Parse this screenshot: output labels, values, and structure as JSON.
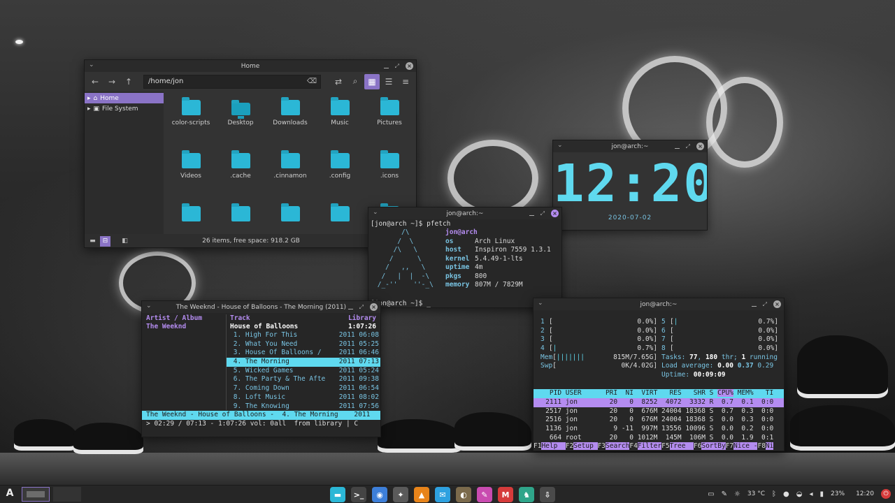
{
  "file_manager": {
    "title": "Home",
    "path": "/home/jon",
    "sidebar": [
      {
        "label": "Home",
        "selected": true
      },
      {
        "label": "File System",
        "selected": false
      }
    ],
    "items": [
      "color-scripts",
      "Desktop",
      "Downloads",
      "Music",
      "Pictures",
      "Videos",
      ".cache",
      ".cinnamon",
      ".config",
      ".icons",
      "",
      "",
      "",
      "",
      ""
    ],
    "status": "26 items, free space: 918.2 GB"
  },
  "clock": {
    "title": "jon@arch:~",
    "time": "12:20",
    "date": "2020-07-02"
  },
  "pfetch": {
    "title": "jon@arch:~",
    "prompt": "[jon@arch ~]$ pfetch",
    "user": "jon@arch",
    "rows": [
      {
        "key": "os",
        "value": "Arch Linux"
      },
      {
        "key": "host",
        "value": "Inspiron 7559 1.3.1"
      },
      {
        "key": "kernel",
        "value": "5.4.49-1-lts"
      },
      {
        "key": "uptime",
        "value": "4m"
      },
      {
        "key": "pkgs",
        "value": "800"
      },
      {
        "key": "memory",
        "value": "807M / 7829M"
      }
    ],
    "prompt2": "[jon@arch ~]$ _"
  },
  "cmus": {
    "title": "The Weeknd - House of Balloons - The Morning (2011)",
    "col_artist": "Artist / Album",
    "col_track": "Track",
    "col_library": "Library",
    "artist": "The Weeknd",
    "album": "House of Balloons",
    "album_duration": "1:07:26",
    "tracks": [
      {
        "name": " 1. High For This",
        "year": "2011",
        "dur": "06:08",
        "selected": false
      },
      {
        "name": " 2. What You Need",
        "year": "2011",
        "dur": "05:25",
        "selected": false
      },
      {
        "name": " 3. House Of Balloons /",
        "year": "2011",
        "dur": "06:46",
        "selected": false
      },
      {
        "name": " 4. The Morning",
        "year": "2011",
        "dur": "07:13",
        "selected": true
      },
      {
        "name": " 5. Wicked Games",
        "year": "2011",
        "dur": "05:24",
        "selected": false
      },
      {
        "name": " 6. The Party & The Afte",
        "year": "2011",
        "dur": "09:38",
        "selected": false
      },
      {
        "name": " 7. Coming Down",
        "year": "2011",
        "dur": "06:54",
        "selected": false
      },
      {
        "name": " 8. Loft Music",
        "year": "2011",
        "dur": "08:02",
        "selected": false
      },
      {
        "name": " 9. The Knowing",
        "year": "2011",
        "dur": "07:56",
        "selected": false
      }
    ],
    "status": "The Weeknd - House of Balloons -  4. The Morning    2011",
    "status2": "> 02:29 / 07:13 - 1:07:26 vol: 0all  from library | C"
  },
  "htop": {
    "title": "jon@arch:~",
    "meters": [
      {
        "l_num": "1",
        "l_bar": "",
        "l_val": "0.0%",
        "r_num": "5",
        "r_bar": "|",
        "r_val": "0.7%"
      },
      {
        "l_num": "2",
        "l_bar": "",
        "l_val": "0.0%",
        "r_num": "6",
        "r_bar": "",
        "r_val": "0.0%"
      },
      {
        "l_num": "3",
        "l_bar": "",
        "l_val": "0.0%",
        "r_num": "7",
        "r_bar": "",
        "r_val": "0.0%"
      },
      {
        "l_num": "4",
        "l_bar": "|",
        "l_val": "0.7%",
        "r_num": "8",
        "r_bar": "",
        "r_val": "0.0%"
      }
    ],
    "mem_label": "Mem",
    "mem_bar": "|||||||",
    "mem_val": "815M/7.65G",
    "swp_label": "Swp",
    "swp_val": "0K/4.02G",
    "tasks_prefix": "Tasks: ",
    "tasks_count": "77",
    "tasks_mid": ", ",
    "thr_count": "180",
    "tasks_suffix": " thr; ",
    "running_count": "1",
    "running_suffix": " running",
    "load_prefix": "Load average: ",
    "load1": "0.00",
    "load5": "0.37",
    "load15": "0.29",
    "uptime_prefix": "Uptime: ",
    "uptime": "00:09:09",
    "header_pre": "    PID USER      PRI  NI  VIRT   RES   SHR S ",
    "header_cpu": "CPU%",
    "header_post": " MEM%   TI",
    "rows": [
      {
        "text": "   2111 jon        20   0  8252  4072  3332 R  0.7  0.1  0:0",
        "selected": true
      },
      {
        "text": "   2517 jon        20   0  676M 24004 18368 S  0.7  0.3  0:0",
        "selected": false
      },
      {
        "text": "   2516 jon        20   0  676M 24004 18368 S  0.0  0.3  0:0",
        "selected": false
      },
      {
        "text": "   1136 jon         9 -11  997M 13556 10096 S  0.0  0.2  0:0",
        "selected": false
      },
      {
        "text": "    664 root       20   0 1012M  145M  106M S  0.0  1.9  0:1",
        "selected": false
      }
    ],
    "keys": [
      {
        "k": "F1",
        "l": "Help  "
      },
      {
        "k": "F2",
        "l": "Setup "
      },
      {
        "k": "F3",
        "l": "Search"
      },
      {
        "k": "F4",
        "l": "Filter"
      },
      {
        "k": "F5",
        "l": "Tree  "
      },
      {
        "k": "F6",
        "l": "SortBy"
      },
      {
        "k": "F7",
        "l": "Nice -"
      },
      {
        "k": "F8",
        "l": "Ni"
      }
    ]
  },
  "taskbar": {
    "launcher": "A",
    "apps": [
      {
        "name": "files",
        "color": "#2bb7d6",
        "glyph": "▬"
      },
      {
        "name": "terminal",
        "color": "#444444",
        "glyph": ">_"
      },
      {
        "name": "chromium",
        "color": "#3d7fd9",
        "glyph": "◉"
      },
      {
        "name": "bird",
        "color": "#5a5a5a",
        "glyph": "✦"
      },
      {
        "name": "vlc",
        "color": "#e8841a",
        "glyph": "▲"
      },
      {
        "name": "mail",
        "color": "#2ea1e0",
        "glyph": "✉"
      },
      {
        "name": "gimp",
        "color": "#7b6a4c",
        "glyph": "◐"
      },
      {
        "name": "pen",
        "color": "#c94bb0",
        "glyph": "✎"
      },
      {
        "name": "gmail",
        "color": "#d63b3b",
        "glyph": "M"
      },
      {
        "name": "gecko",
        "color": "#2fa58a",
        "glyph": "♞"
      },
      {
        "name": "download",
        "color": "#4a4a4a",
        "glyph": "⇩"
      }
    ],
    "weather": "33 °C",
    "battery": "23%",
    "time": "12:20"
  }
}
